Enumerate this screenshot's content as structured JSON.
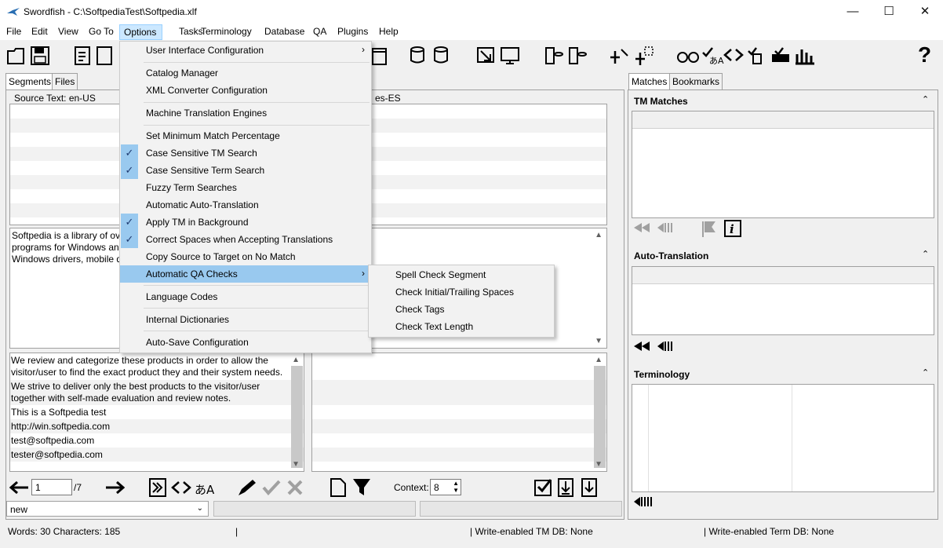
{
  "window": {
    "title": "Swordfish - C:\\SoftpediaTest\\Softpedia.xlf",
    "minimize": "—",
    "maximize": "☐",
    "close": "✕"
  },
  "menubar": [
    "File",
    "Edit",
    "View",
    "Go To",
    "Options",
    "Tasks",
    "Terminology",
    "Database",
    "QA",
    "Plugins",
    "Help"
  ],
  "left_tabs": {
    "segments": "Segments",
    "files": "Files"
  },
  "source_header": "Source Text: en-US",
  "target_header_partial": "es-ES",
  "source_preview": [
    "Softpedia is a library of ov",
    "programs for Windows an",
    "Windows drivers, mobile d"
  ],
  "segments": [
    "We review and categorize these products in order to allow the",
    "visitor/user to find the exact product they and their system needs.",
    "We strive to deliver only the best products to the visitor/user",
    "together with self-made evaluation and review notes.",
    "This is a Softpedia test",
    "http://win.softpedia.com",
    "test@softpedia.com",
    "tester@softpedia.com"
  ],
  "nav": {
    "segment_number": "1",
    "total": "/7",
    "context_label": "Context:",
    "context_value": "8"
  },
  "status_select": "new",
  "right_tabs": {
    "matches": "Matches",
    "bookmarks": "Bookmarks"
  },
  "sections": {
    "tm_matches": "TM Matches",
    "auto_translation": "Auto-Translation",
    "terminology": "Terminology"
  },
  "options_menu": [
    {
      "label": "User Interface Configuration",
      "checked": false,
      "submenu": true
    },
    {
      "label": "Catalog Manager",
      "checked": false
    },
    {
      "label": "XML Converter Configuration",
      "checked": false
    },
    {
      "label": "Machine Translation Engines",
      "checked": false
    },
    {
      "label": "Set Minimum Match Percentage",
      "checked": false
    },
    {
      "label": "Case Sensitive TM Search",
      "checked": true
    },
    {
      "label": "Case Sensitive Term Search",
      "checked": true
    },
    {
      "label": "Fuzzy Term Searches",
      "checked": false
    },
    {
      "label": "Automatic Auto-Translation",
      "checked": false
    },
    {
      "label": "Apply TM in Background",
      "checked": true
    },
    {
      "label": "Correct Spaces when Accepting Translations",
      "checked": true
    },
    {
      "label": "Copy Source to Target on No Match",
      "checked": false
    },
    {
      "label": "Automatic QA Checks",
      "checked": false,
      "submenu": true,
      "highlighted": true
    },
    {
      "label": "Language Codes",
      "checked": false
    },
    {
      "label": "Internal Dictionaries",
      "checked": false
    },
    {
      "label": "Auto-Save Configuration",
      "checked": false
    }
  ],
  "qa_submenu": [
    "Spell Check Segment",
    "Check Initial/Trailing Spaces",
    "Check Tags",
    "Check Text Length"
  ],
  "statusbar": {
    "counts": "Words: 30 Characters: 185",
    "tm_db": "| Write-enabled TM DB: None",
    "term_db": "| Write-enabled Term DB: None",
    "sep": "|"
  },
  "colors": {
    "menu_highlight": "#99c9ef",
    "check_bg": "#99c9ef",
    "menu_hover": "#cce8ff"
  }
}
